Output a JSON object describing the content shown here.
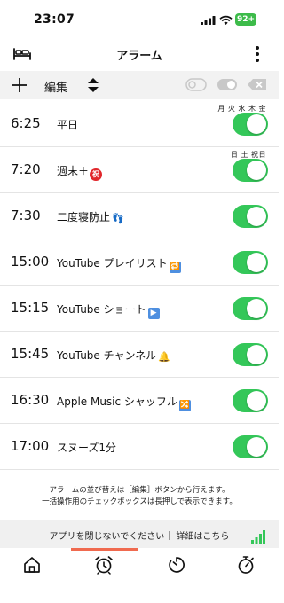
{
  "status_bar": {
    "time": "23:07",
    "battery": "92+",
    "signal_icon": "cellular-signal-icon",
    "wifi_icon": "wifi-icon",
    "battery_color": "#3dbb4a"
  },
  "nav": {
    "title": "アラーム",
    "left_icon": "bed-icon",
    "right_icon": "more-vertical-icon"
  },
  "toolbar": {
    "edit_label": "編集",
    "add_icon": "plus-icon",
    "sort_icon": "sort-icon",
    "toggle_off_icon": "toggle-off-icon",
    "toggle_on_icon": "toggle-on-icon",
    "delete_icon": "delete-icon"
  },
  "alarms": [
    {
      "time": "6:25",
      "label": "平日",
      "days": "月 火 水 木 金",
      "enabled": true
    },
    {
      "time": "7:20",
      "label": "週末＋",
      "emoji": "祝",
      "days": "日 土 祝日",
      "enabled": true
    },
    {
      "time": "7:30",
      "label": "二度寝防止",
      "emoji": "👣",
      "days": "",
      "enabled": true
    },
    {
      "time": "15:00",
      "label": "YouTube プレイリスト",
      "emoji": "🔁",
      "days": "",
      "enabled": true
    },
    {
      "time": "15:15",
      "label": "YouTube ショート",
      "emoji": "▶",
      "days": "",
      "enabled": true
    },
    {
      "time": "15:45",
      "label": "YouTube チャンネル",
      "emoji": "🔔",
      "days": "",
      "enabled": true
    },
    {
      "time": "16:30",
      "label": "Apple Music シャッフル",
      "emoji": "🔀",
      "days": "",
      "enabled": true
    },
    {
      "time": "17:00",
      "label": "スヌーズ1分",
      "days": "",
      "enabled": true
    }
  ],
  "footer": {
    "line1": "アラームの並び替えは［編集］ボタンから行えます。",
    "line2": "一括操作用のチェックボックスは長押しで表示できます。"
  },
  "banner": {
    "text": "アプリを閉じないでください｜ 詳細はこちら",
    "bars_icon": "signal-bars-icon"
  },
  "tabs": [
    {
      "name": "home",
      "icon": "home-icon"
    },
    {
      "name": "alarm",
      "icon": "alarm-clock-icon",
      "selected": true
    },
    {
      "name": "timer",
      "icon": "timer-icon"
    },
    {
      "name": "stopwatch",
      "icon": "stopwatch-icon"
    }
  ],
  "colors": {
    "switch_on": "#34c759",
    "tab_indicator": "#f06a4f",
    "toolbar_bg": "#f2f2f2"
  }
}
